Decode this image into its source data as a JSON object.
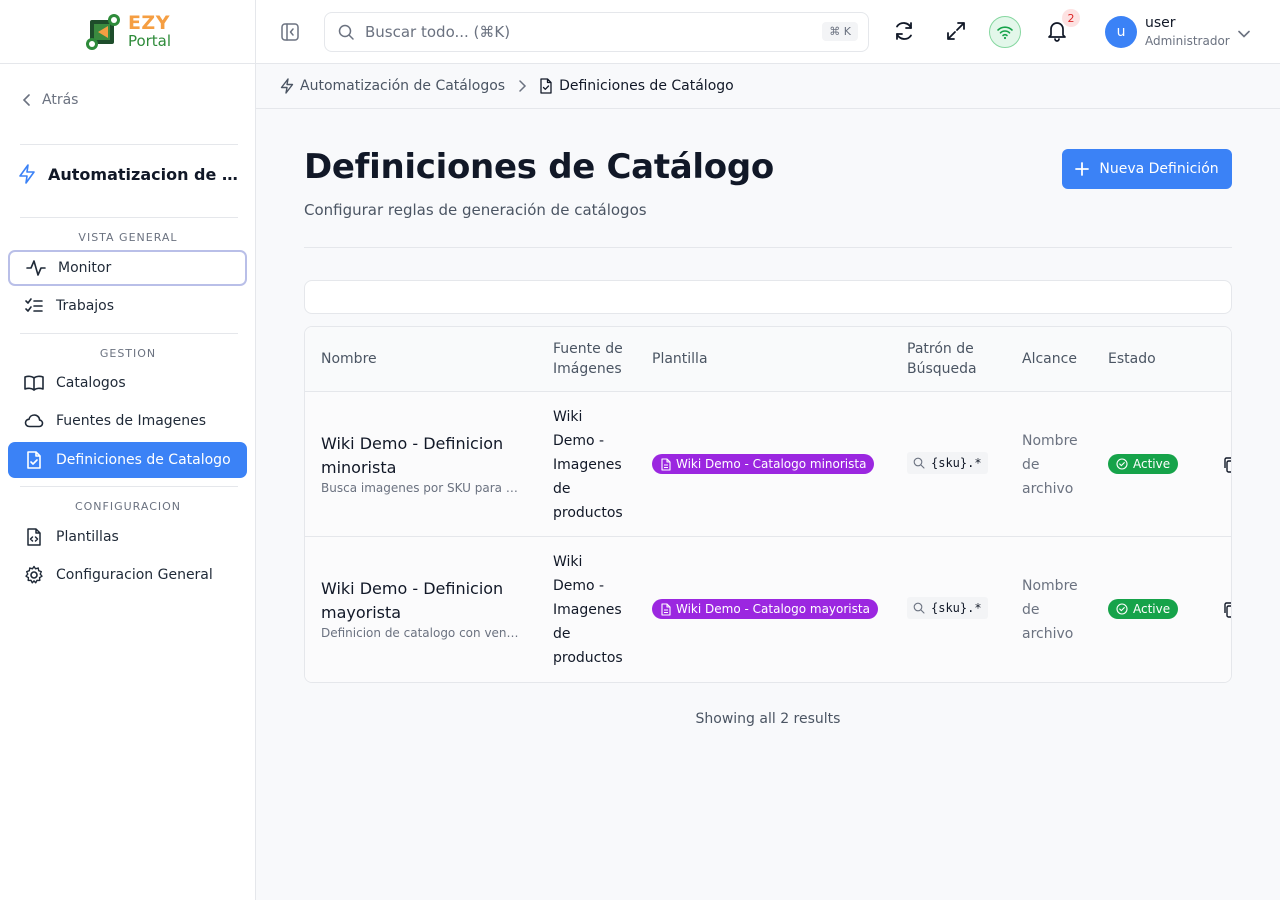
{
  "brand": {
    "name_top": "EZY",
    "name_bottom": "Portal"
  },
  "sidebar": {
    "back_label": "Atrás",
    "module_title": "Automatizacion de Catalogos",
    "sections": [
      {
        "label": "VISTA GENERAL"
      },
      {
        "label": "GESTION"
      },
      {
        "label": "CONFIGURACION"
      }
    ],
    "items": [
      {
        "label": "Monitor",
        "icon": "activity-icon"
      },
      {
        "label": "Trabajos",
        "icon": "list-checks-icon"
      },
      {
        "label": "Catalogos",
        "icon": "book-open-icon"
      },
      {
        "label": "Fuentes de Imagenes",
        "icon": "cloud-icon"
      },
      {
        "label": "Definiciones de Catalogo",
        "icon": "file-check-icon",
        "active": true
      },
      {
        "label": "Plantillas",
        "icon": "file-code-icon"
      },
      {
        "label": "Configuracion General",
        "icon": "settings-icon"
      }
    ]
  },
  "header": {
    "search_placeholder": "Buscar todo... (⌘K)",
    "search_shortcut": "⌘ K",
    "notification_count": "2",
    "user_initial": "u",
    "user_name": "user",
    "user_role": "Administrador",
    "status_color": "#16a34a"
  },
  "breadcrumb": {
    "parent": "Automatización de Catálogos",
    "current": "Definiciones de Catálogo"
  },
  "page": {
    "title": "Definiciones de Catálogo",
    "subtitle": "Configurar reglas de generación de catálogos",
    "new_button": "Nueva Definición",
    "accent_color": "#3b82f6"
  },
  "table": {
    "columns": {
      "nombre": "Nombre",
      "fuente_l1": "Fuente de",
      "fuente_l2": "Imágenes",
      "plantilla": "Plantilla",
      "patron_l1": "Patrón de",
      "patron_l2": "Búsqueda",
      "alcance": "Alcance",
      "estado": "Estado"
    },
    "rows": [
      {
        "name_l1": "Wiki Demo - Definicion",
        "name_l2": "minorista",
        "description": "Busca imagenes por SKU para catalogo minorista",
        "fuente": [
          "Wiki",
          "Demo -",
          "Imagenes",
          "de",
          "productos"
        ],
        "plantilla": "Wiki Demo - Catalogo minorista",
        "patron": "{sku}.*",
        "alcance": [
          "Nombre",
          "de",
          "archivo"
        ],
        "estado": "Active"
      },
      {
        "name_l1": "Wiki Demo - Definicion",
        "name_l2": "mayorista",
        "description": "Definicion de catalogo con vencimiento mayorista",
        "fuente": [
          "Wiki",
          "Demo -",
          "Imagenes",
          "de",
          "productos"
        ],
        "plantilla": "Wiki Demo - Catalogo mayorista",
        "patron": "{sku}.*",
        "alcance": [
          "Nombre",
          "de",
          "archivo"
        ],
        "estado": "Active"
      }
    ],
    "footer": "Showing all 2 results",
    "template_badge_color": "#9b27e0",
    "status_badge_color": "#16a34a"
  }
}
